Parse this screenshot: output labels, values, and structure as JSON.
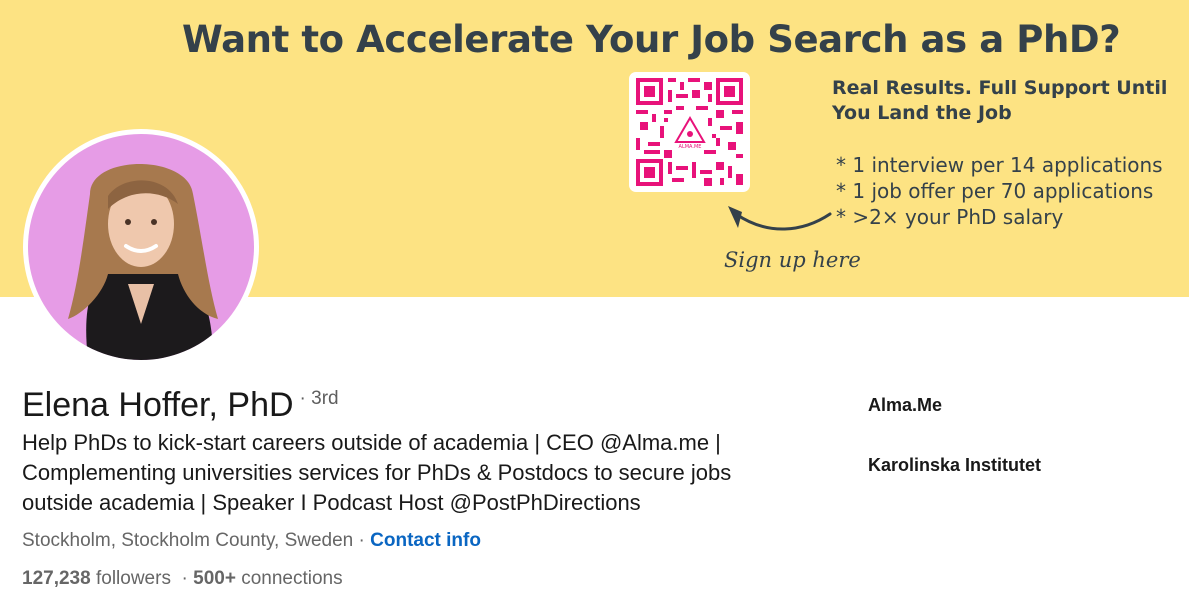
{
  "banner": {
    "headline": "Want to Accelerate Your Job Search as a PhD?",
    "subheadline": "Real Results. Full Support Until You Land the Job",
    "bullets": [
      "* 1 interview per 14 applications",
      "* 1 job offer per 70 applications",
      "* >2× your PhD salary"
    ],
    "cta": "Sign up here",
    "qr_logo_text": "ALMA.ME"
  },
  "profile": {
    "name": "Elena Hoffer, PhD",
    "degree": "· 3rd",
    "headline": "Help PhDs to kick-start careers outside of academia | CEO @Alma.me | Complementing universities services for PhDs & Postdocs to secure jobs outside academia | Speaker I Podcast Host @PostPhDirections",
    "location": "Stockholm, Stockholm County, Sweden",
    "separator": " · ",
    "contact_label": "Contact info",
    "followers_count": "127,238",
    "followers_label": "followers",
    "connections_count": "500+",
    "connections_label": "connections"
  },
  "sidebar": {
    "company": "Alma.Me",
    "education": "Karolinska Institutet"
  },
  "colors": {
    "banner_bg": "#fde383",
    "banner_text": "#34414a",
    "qr": "#e8127a",
    "avatar_bg": "#e69ce6",
    "link": "#0a66c2"
  }
}
